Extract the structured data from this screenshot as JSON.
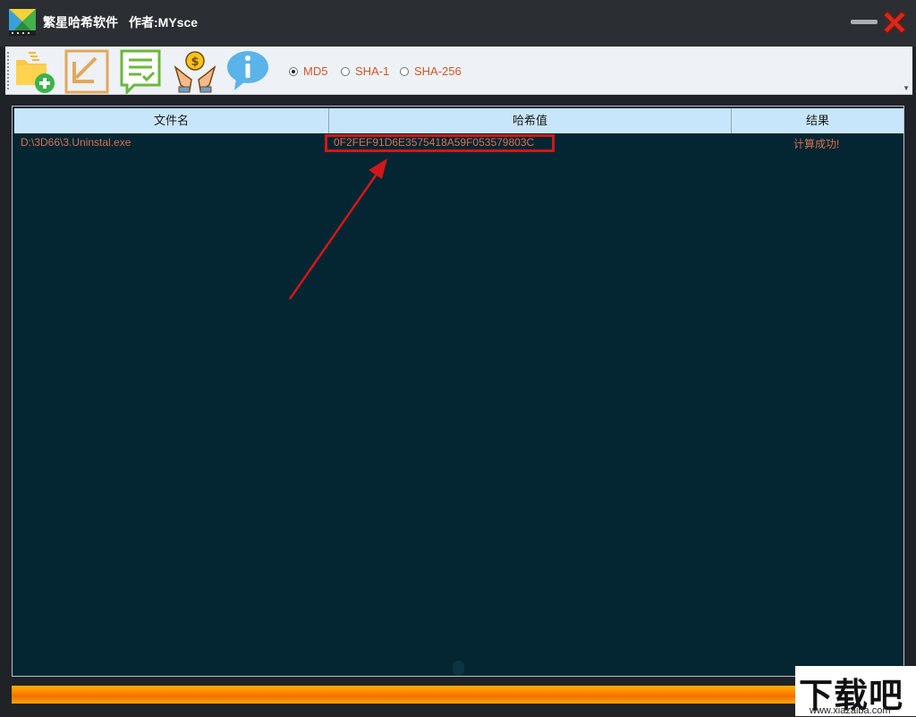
{
  "titlebar": {
    "app_name": "繁星哈希软件",
    "author": "作者:MYsce"
  },
  "toolbar": {
    "buttons": [
      {
        "name": "add-file-button",
        "icon": "folder-add-icon"
      },
      {
        "name": "import-button",
        "icon": "arrow-down-left-icon"
      },
      {
        "name": "checklist-button",
        "icon": "checklist-icon"
      },
      {
        "name": "donate-button",
        "icon": "coin-hands-icon"
      },
      {
        "name": "about-button",
        "icon": "info-icon"
      }
    ],
    "algorithms": [
      {
        "label": "MD5",
        "selected": true
      },
      {
        "label": "SHA-1",
        "selected": false
      },
      {
        "label": "SHA-256",
        "selected": false
      }
    ]
  },
  "list": {
    "columns": [
      "文件名",
      "哈希值",
      "结果"
    ],
    "rows": [
      {
        "file": "D:\\3D66\\3.Uninstal.exe",
        "hash": "0F2FEF91D6E3575418A59F053579803C",
        "result": "计算成功!"
      }
    ]
  },
  "progress": {
    "percent": 100,
    "color": "#ff8a00"
  },
  "watermark": {
    "main": "下载吧",
    "sub": "www.xiazaiba.com"
  },
  "colors": {
    "list_background": "#032632",
    "header_background": "#c8e6fb",
    "row_text": "#d87050",
    "highlight": "#d01818",
    "radio_text": "#d0562a"
  }
}
